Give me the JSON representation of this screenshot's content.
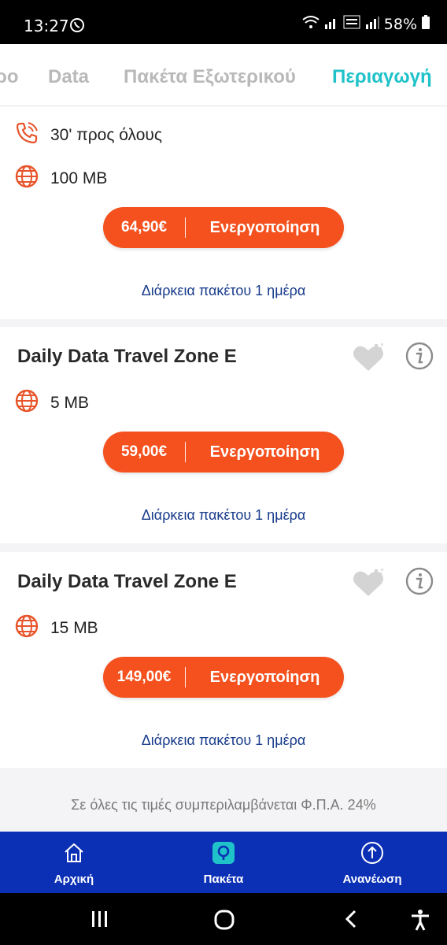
{
  "status_bar": {
    "time": "13:27",
    "battery": "58%"
  },
  "tabs": [
    {
      "label": "ρο",
      "active": false
    },
    {
      "label": "Data",
      "active": false
    },
    {
      "label": "Πακέτα Εξωτερικού",
      "active": false
    },
    {
      "label": "Περιαγωγή",
      "active": true
    }
  ],
  "cards": [
    {
      "features": [
        {
          "icon": "phone-icon",
          "text": "30' προς όλους"
        },
        {
          "icon": "globe-icon",
          "text": "100 MB"
        }
      ],
      "price": "64,90€",
      "action": "Ενεργοποίηση",
      "duration": "Διάρκεια πακέτου 1 ημέρα"
    },
    {
      "title": "Daily Data Travel Zone E",
      "features": [
        {
          "icon": "globe-icon",
          "text": "5 MB"
        }
      ],
      "price": "59,00€",
      "action": "Ενεργοποίηση",
      "duration": "Διάρκεια πακέτου 1 ημέρα"
    },
    {
      "title": "Daily Data Travel Zone E",
      "features": [
        {
          "icon": "globe-icon",
          "text": "15 MB"
        }
      ],
      "price": "149,00€",
      "action": "Ενεργοποίηση",
      "duration": "Διάρκεια πακέτου 1 ημέρα"
    }
  ],
  "footnote": "Σε όλες τις τιμές συμπεριλαμβάνεται Φ.Π.Α. 24%",
  "bottom_nav": [
    {
      "icon": "home-icon",
      "label": "Αρχική"
    },
    {
      "icon": "packages-icon",
      "label": "Πακέτα"
    },
    {
      "icon": "topup-icon",
      "label": "Ανανέωση"
    }
  ],
  "colors": {
    "accent_orange": "#f4511e",
    "tab_active": "#1fc2c9",
    "nav_blue": "#0b2fb5",
    "duration_blue": "#163a8a"
  }
}
